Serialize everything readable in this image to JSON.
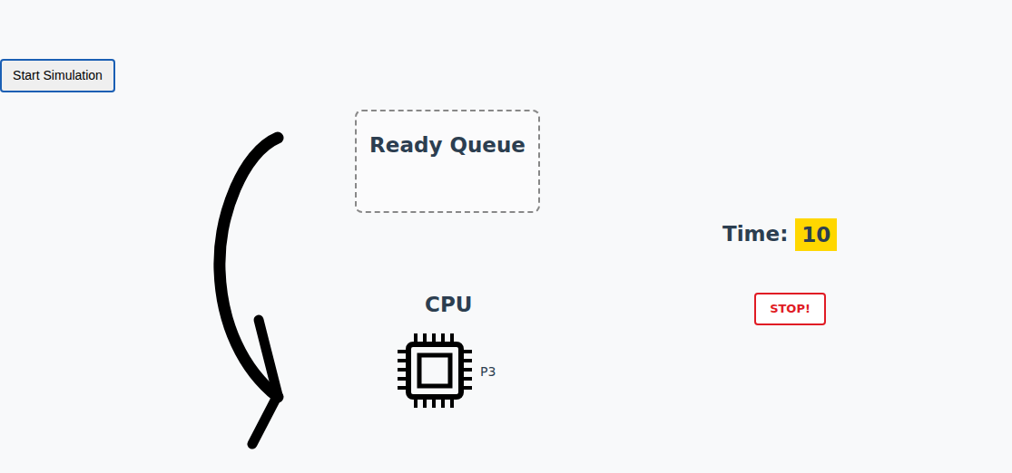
{
  "controls": {
    "start_button": "Start Simulation"
  },
  "ready_queue": {
    "title": "Ready Queue",
    "processes": []
  },
  "clock": {
    "label": "Time:",
    "value": "10"
  },
  "cpu": {
    "title": "CPU",
    "process": "P3"
  },
  "stop_button": "STOP!"
}
